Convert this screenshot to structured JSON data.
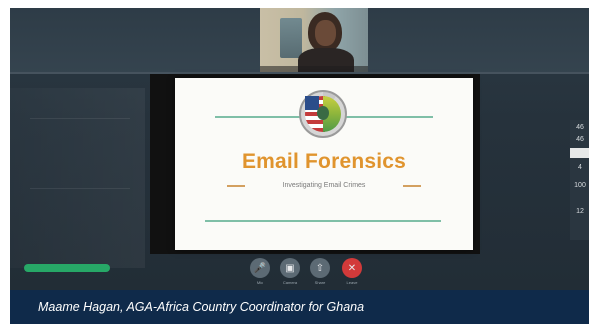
{
  "slide": {
    "title": "Email Forensics",
    "subtitle": "Investigating Email Crimes"
  },
  "controls": {
    "buttons": [
      {
        "icon": "microphone-icon",
        "label": "Mic"
      },
      {
        "icon": "camera-icon",
        "label": "Camera"
      },
      {
        "icon": "share-icon",
        "label": "Share"
      },
      {
        "icon": "end-call-icon",
        "label": "Leave"
      }
    ]
  },
  "right_widget": {
    "items": [
      "46",
      "46",
      "4",
      "100",
      "12"
    ]
  },
  "caption": {
    "text": "Maame Hagan, AGA-Africa Country Coordinator for Ghana"
  },
  "colors": {
    "caption_bg": "#0f2a4a",
    "slide_title": "#e0942e",
    "slide_rule": "#7fbfa7",
    "end_call": "#d23a3a",
    "status_pill": "#27a867"
  }
}
